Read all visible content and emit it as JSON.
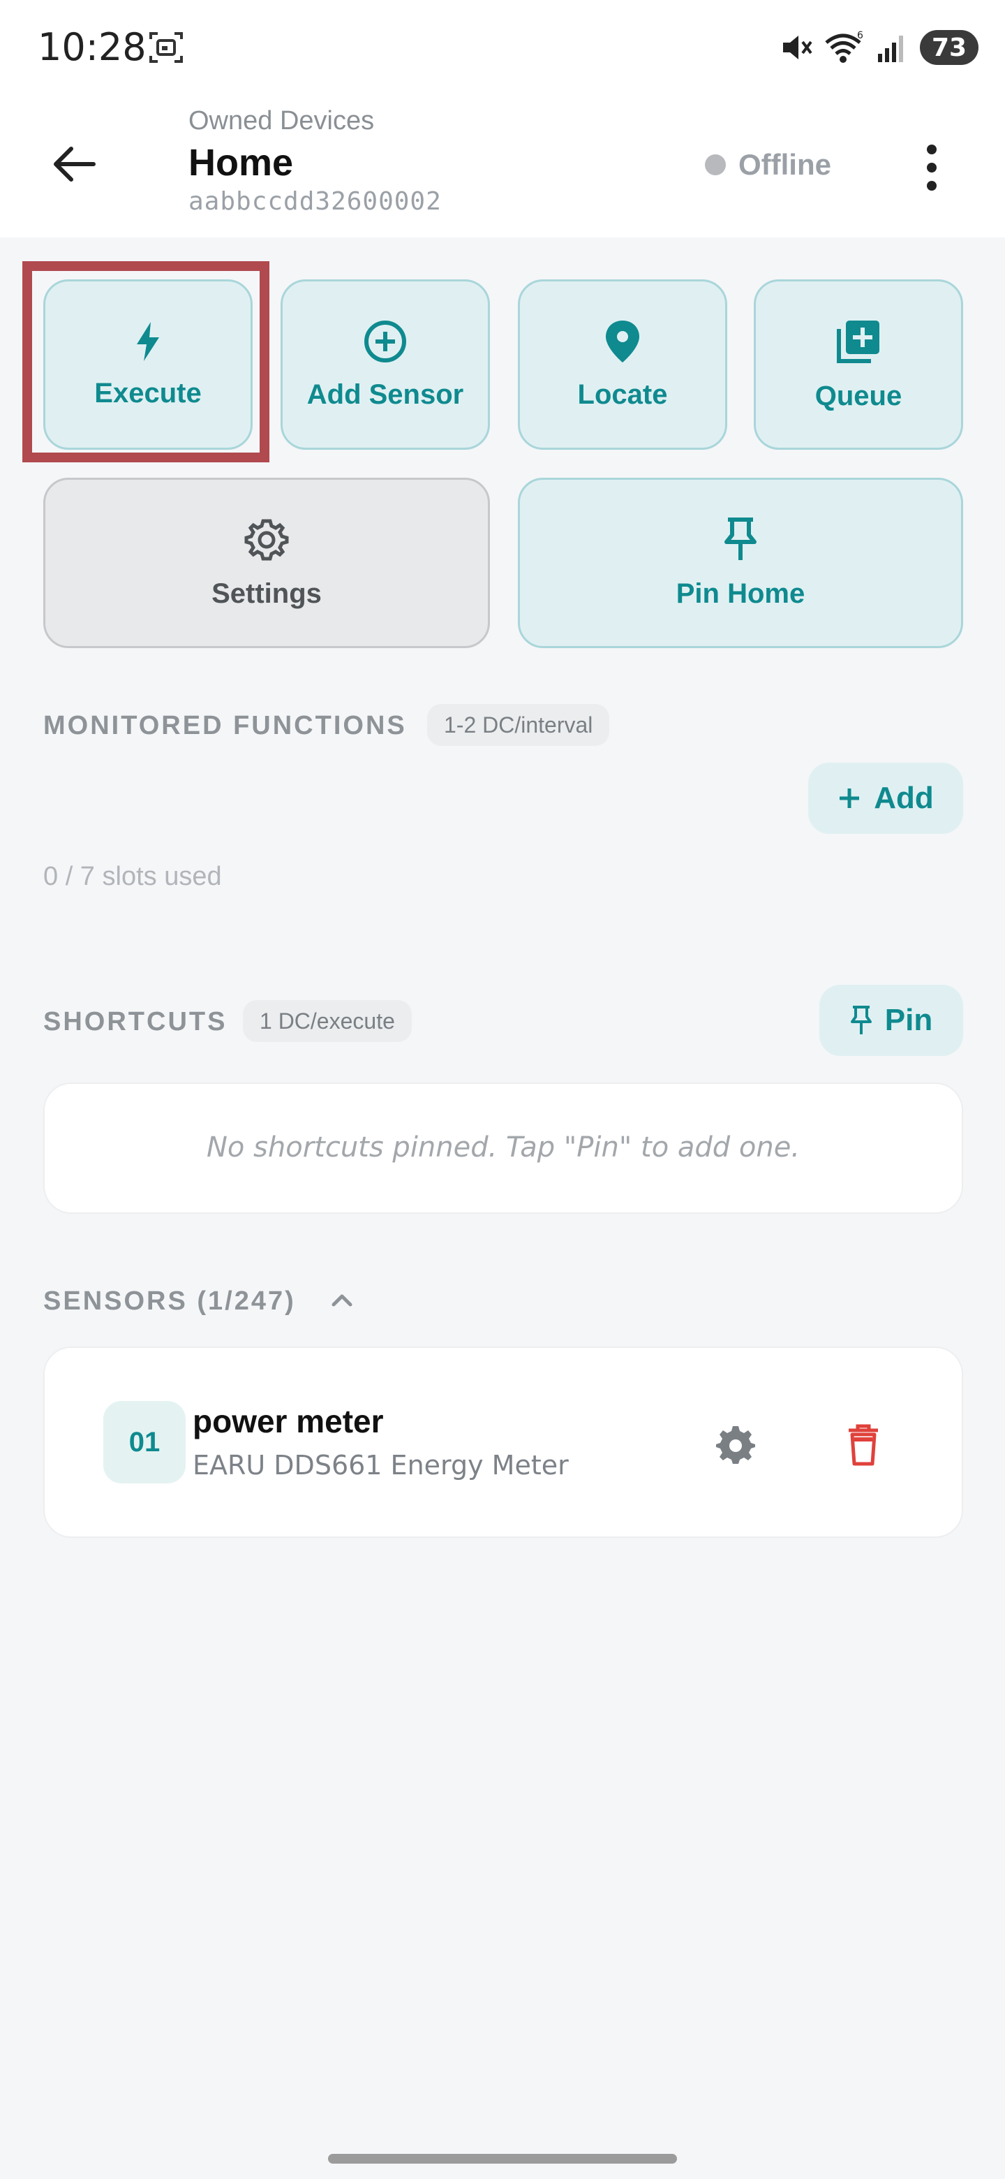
{
  "status_bar": {
    "time": "10:28",
    "battery": "73",
    "icons": [
      "screenshot-icon",
      "mute-icon",
      "wifi-icon",
      "signal-icon",
      "battery-icon"
    ]
  },
  "app_bar": {
    "subtitle": "Owned Devices",
    "title": "Home",
    "device_id": "aabbccdd32600002",
    "status": "Offline",
    "status_color": "#b7b9bd"
  },
  "actions": [
    {
      "label": "Execute",
      "icon": "bolt-icon"
    },
    {
      "label": "Add Sensor",
      "icon": "add-circle-icon"
    },
    {
      "label": "Locate",
      "icon": "location-pin-icon"
    },
    {
      "label": "Queue",
      "icon": "queue-add-icon"
    },
    {
      "label": "Settings",
      "icon": "gear-icon"
    },
    {
      "label": "Pin Home",
      "icon": "pin-icon"
    }
  ],
  "monitored": {
    "title": "MONITORED FUNCTIONS",
    "chip": "1-2 DC/interval",
    "add_label": "Add",
    "slots": "0 / 7 slots used"
  },
  "shortcuts": {
    "title": "SHORTCUTS",
    "chip": "1 DC/execute",
    "pin_label": "Pin",
    "empty": "No shortcuts pinned. Tap \"Pin\" to add one."
  },
  "sensors": {
    "title": "SENSORS (1/247)",
    "items": [
      {
        "number": "01",
        "name": "power meter",
        "model": "EARU DDS661 Energy Meter"
      }
    ]
  },
  "colors": {
    "accent": "#0f8a8f",
    "tile_bg": "#e0f0f2",
    "danger": "#e0413b",
    "highlight": "#b04a4e"
  }
}
